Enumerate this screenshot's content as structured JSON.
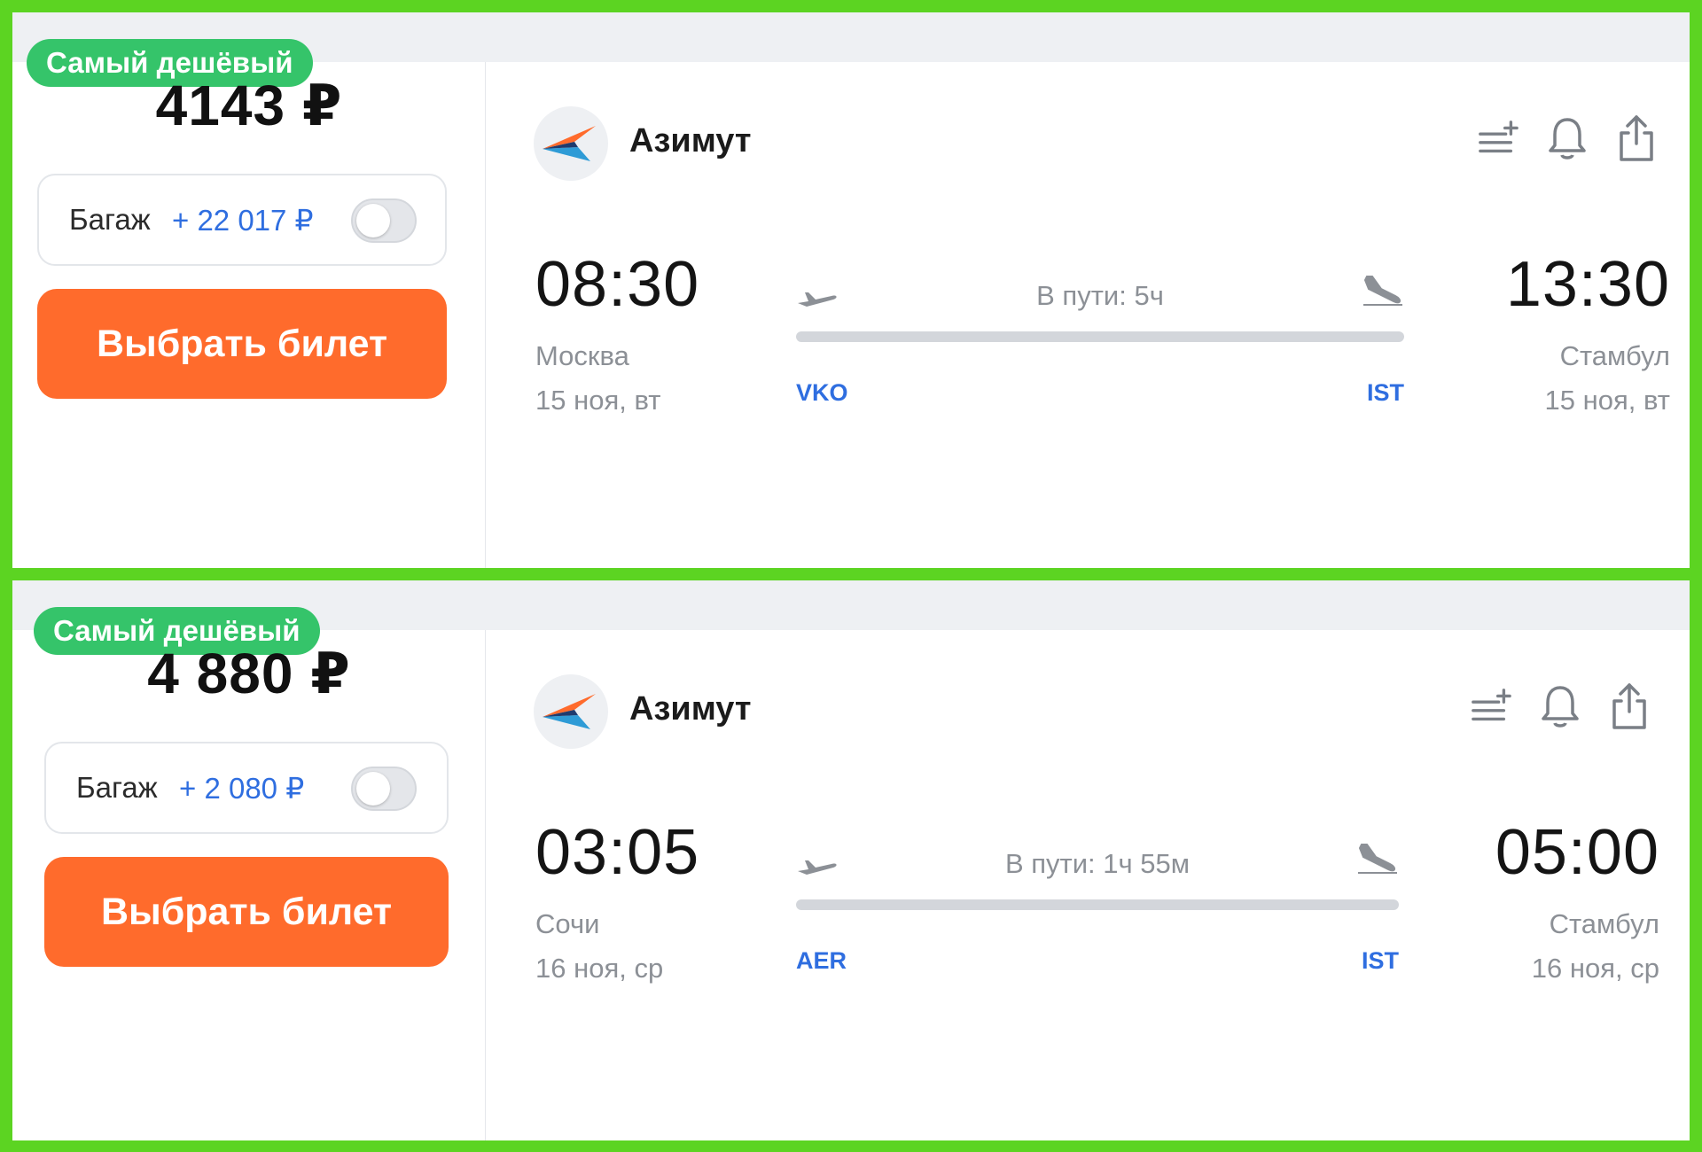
{
  "colors": {
    "frame": "#5cd422",
    "badge": "#35c46a",
    "button": "#ff6b2c",
    "link": "#2f6ee0"
  },
  "tickets": [
    {
      "badge": "Самый дешёвый",
      "price": "4143 ₽",
      "baggage_label": "Багаж",
      "baggage_price": "+ 22 017 ₽",
      "select_label": "Выбрать билет",
      "airline": "Азимут",
      "departure": {
        "time": "08:30",
        "city": "Москва",
        "date": "15 ноя, вт",
        "code": "VKO"
      },
      "arrival": {
        "time": "13:30",
        "city": "Стамбул",
        "date": "15 ноя, вт",
        "code": "IST"
      },
      "duration": "В пути: 5ч"
    },
    {
      "badge": "Самый дешёвый",
      "price": "4 880 ₽",
      "baggage_label": "Багаж",
      "baggage_price": "+ 2 080 ₽",
      "select_label": "Выбрать билет",
      "airline": "Азимут",
      "departure": {
        "time": "03:05",
        "city": "Сочи",
        "date": "16 ноя, ср",
        "code": "AER"
      },
      "arrival": {
        "time": "05:00",
        "city": "Стамбул",
        "date": "16 ноя, ср",
        "code": "IST"
      },
      "duration": "В пути: 1ч 55м"
    }
  ]
}
